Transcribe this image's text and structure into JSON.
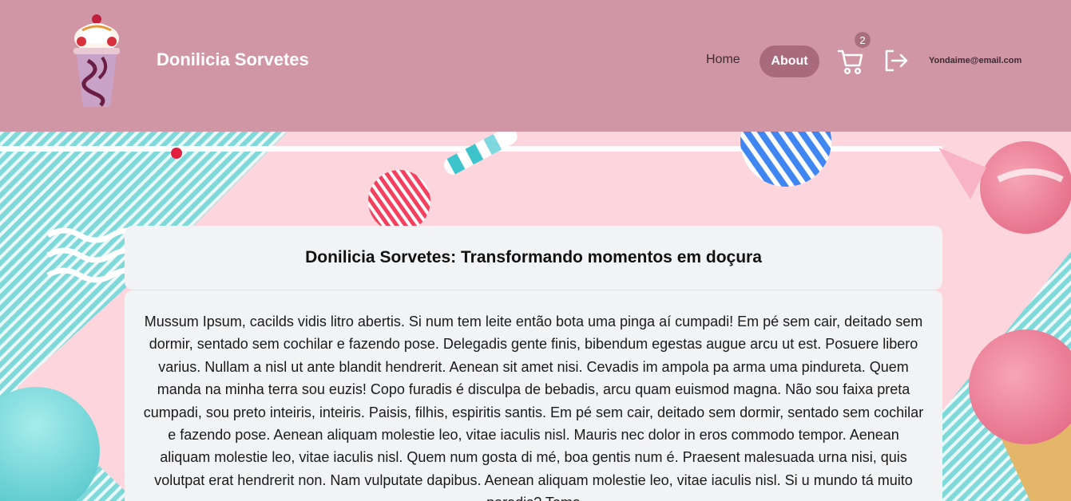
{
  "header": {
    "brand": "Donilicia Sorvetes",
    "nav": {
      "home": "Home",
      "about": "About"
    },
    "cart_count": "2",
    "user_email": "Yondaime@email.com"
  },
  "icons": {
    "logo": "milkshake-logo-icon",
    "cart": "shopping-cart-icon",
    "logout": "logout-icon"
  },
  "colors": {
    "header_bg": "#d196a6",
    "active_nav": "#a96a7d",
    "page_bg": "#fcd6dc",
    "card_bg": "#f2f3f5",
    "teal_stripes": "#6fd3d4"
  },
  "main": {
    "title": "Donilicia Sorvetes: Transformando momentos em doçura",
    "body": "Mussum Ipsum, cacilds vidis litro abertis. Si num tem leite então bota uma pinga aí cumpadi! Em pé sem cair, deitado sem dormir, sentado sem cochilar e fazendo pose. Delegadis gente finis, bibendum egestas augue arcu ut est. Posuere libero varius. Nullam a nisl ut ante blandit hendrerit. Aenean sit amet nisi. Cevadis im ampola pa arma uma pindureta. Quem manda na minha terra sou euzis! Copo furadis é disculpa de bebadis, arcu quam euismod magna. Não sou faixa preta cumpadi, sou preto inteiris, inteiris. Paisis, filhis, espiritis santis. Em pé sem cair, deitado sem dormir, sentado sem cochilar e fazendo pose. Aenean aliquam molestie leo, vitae iaculis nisl. Mauris nec dolor in eros commodo tempor. Aenean aliquam molestie leo, vitae iaculis nisl. Quem num gosta di mé, boa gentis num é. Praesent malesuada urna nisi, quis volutpat erat hendrerit non. Nam vulputate dapibus. Aenean aliquam molestie leo, vitae iaculis nisl. Si u mundo tá muito paradis? Toma"
  }
}
